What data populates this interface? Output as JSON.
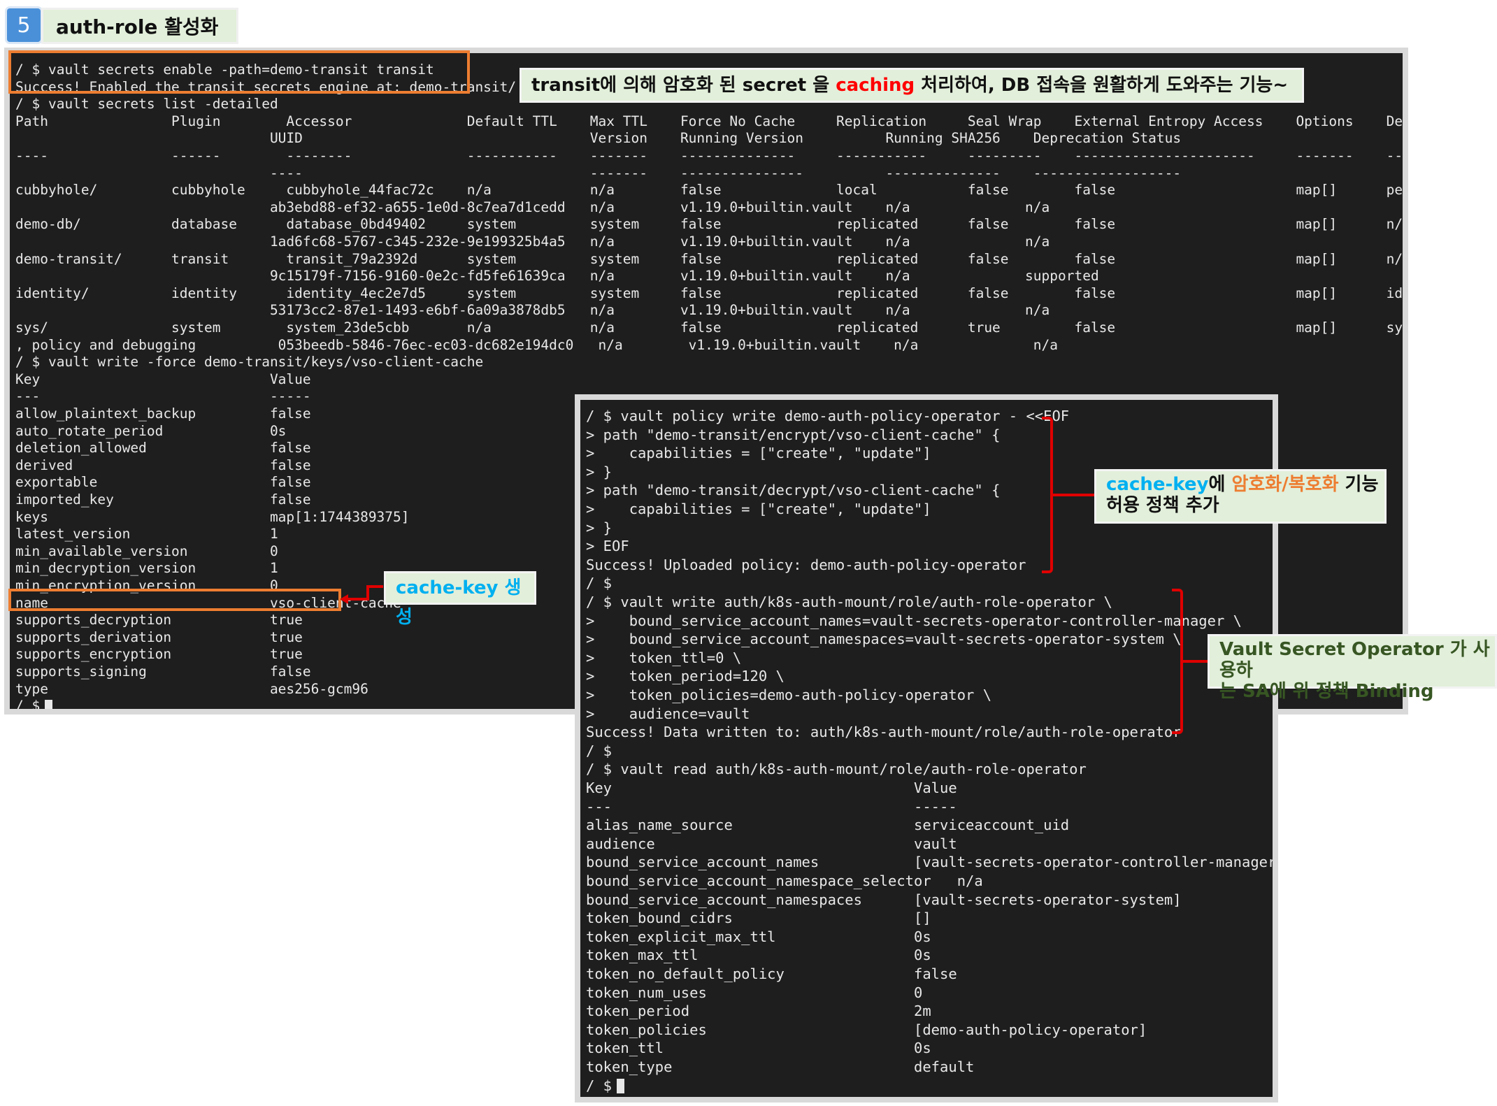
{
  "header": {
    "step_number": "5",
    "title": "auth-role 활성화"
  },
  "terminal1": {
    "lines": [
      "/ $ vault secrets enable -path=demo-transit transit",
      "Success! Enabled the transit secrets engine at: demo-transit/",
      "/ $ vault secrets list -detailed",
      "Path               Plugin        Accessor              Default TTL    Max TTL    Force No Cache     Replication     Seal Wrap    External Entropy Access    Options    Description",
      "                               UUID                                   Version    Running Version          Running SHA256    Deprecation Status",
      "----               ------        --------              -----------    -------    --------------     -----------     ---------    ----------------------     -------    -----------",
      "                               ----                                   -------    ---------------          --------------    ------------------",
      "cubbyhole/         cubbyhole     cubbyhole_44fac72c    n/a            n/a        false              local           false        false                      map[]      per-token private secret storage",
      "                               ab3ebd88-ef32-a655-1e0d-8c7ea7d1cedd   n/a        v1.19.0+builtin.vault    n/a              n/a",
      "demo-db/           database      database_0bd49402     system         system     false              replicated      false        false                      map[]      n/a",
      "                               1ad6fc68-5767-c345-232e-9e199325b4a5   n/a        v1.19.0+builtin.vault    n/a              n/a",
      "demo-transit/      transit       transit_79a2392d      system         system     false              replicated      false        false                      map[]      n/a",
      "                               9c15179f-7156-9160-0e2c-fd5fe61639ca   n/a        v1.19.0+builtin.vault    n/a              supported",
      "identity/          identity      identity_4ec2e7d5     system         system     false              replicated      false        false                      map[]      identity store",
      "                               53173cc2-87e1-1493-e6bf-6a09a3878db5   n/a        v1.19.0+builtin.vault    n/a              n/a",
      "sys/               system        system_23de5cbb       n/a            n/a        false              replicated      true         false                      map[]      system endpoints used for control",
      ", policy and debugging          053beedb-5846-76ec-ec03-dc682e194dc0   n/a        v1.19.0+builtin.vault    n/a              n/a",
      "/ $ vault write -force demo-transit/keys/vso-client-cache",
      "Key                            Value",
      "---                            -----",
      "allow_plaintext_backup         false",
      "auto_rotate_period             0s",
      "deletion_allowed               false",
      "derived                        false",
      "exportable                     false",
      "imported_key                   false",
      "keys                           map[1:1744389375]",
      "latest_version                 1",
      "min_available_version          0",
      "min_decryption_version         1",
      "min_encryption_version         0",
      "name                           vso-client-cache",
      "supports_decryption            true",
      "supports_derivation            true",
      "supports_encryption            true",
      "supports_signing               false",
      "type                           aes256-gcm96",
      "/ $ "
    ]
  },
  "terminal2": {
    "lines": [
      "/ $ vault policy write demo-auth-policy-operator - <<EOF",
      "> path \"demo-transit/encrypt/vso-client-cache\" {",
      ">    capabilities = [\"create\", \"update\"]",
      "> }",
      "> path \"demo-transit/decrypt/vso-client-cache\" {",
      ">    capabilities = [\"create\", \"update\"]",
      "> }",
      "> EOF",
      "Success! Uploaded policy: demo-auth-policy-operator",
      "/ $",
      "/ $ vault write auth/k8s-auth-mount/role/auth-role-operator \\",
      ">    bound_service_account_names=vault-secrets-operator-controller-manager \\",
      ">    bound_service_account_namespaces=vault-secrets-operator-system \\",
      ">    token_ttl=0 \\",
      ">    token_period=120 \\",
      ">    token_policies=demo-auth-policy-operator \\",
      ">    audience=vault",
      "Success! Data written to: auth/k8s-auth-mount/role/auth-role-operator",
      "/ $",
      "/ $ vault read auth/k8s-auth-mount/role/auth-role-operator",
      "Key                                   Value",
      "---                                   -----",
      "alias_name_source                     serviceaccount_uid",
      "audience                              vault",
      "bound_service_account_names           [vault-secrets-operator-controller-manager]",
      "bound_service_account_namespace_selector   n/a",
      "bound_service_account_namespaces      [vault-secrets-operator-system]",
      "token_bound_cidrs                     []",
      "token_explicit_max_ttl                0s",
      "token_max_ttl                         0s",
      "token_no_default_policy               false",
      "token_num_uses                        0",
      "token_period                          2m",
      "token_policies                        [demo-auth-policy-operator]",
      "token_ttl                             0s",
      "token_type                            default",
      "/ $ "
    ]
  },
  "callouts": {
    "transit_prefix": "transit에 의해 암호화 된 secret 을 ",
    "transit_highlight": "caching",
    "transit_suffix": " 처리하여, DB 접속을 원활하게 도와주는 기능~",
    "cachekey_create": "cache-key 생성",
    "policy_part1": "cache-key",
    "policy_part2": "에 ",
    "policy_part3": "암호화/복호화",
    "policy_part4": " 기능",
    "policy_line2": "허용 정책 추가",
    "binding_line1": "Vault Secret Operator 가 사용하",
    "binding_line2": "는 SA에 위 정책 Binding"
  },
  "colors": {
    "terminal_bg": "#1e1e1e",
    "callout_bg": "#e2efda",
    "orange": "#ed7d31",
    "red": "#e00000",
    "cyan": "#00b0f0",
    "green_text": "#375623",
    "caching_red": "#ff0000"
  }
}
